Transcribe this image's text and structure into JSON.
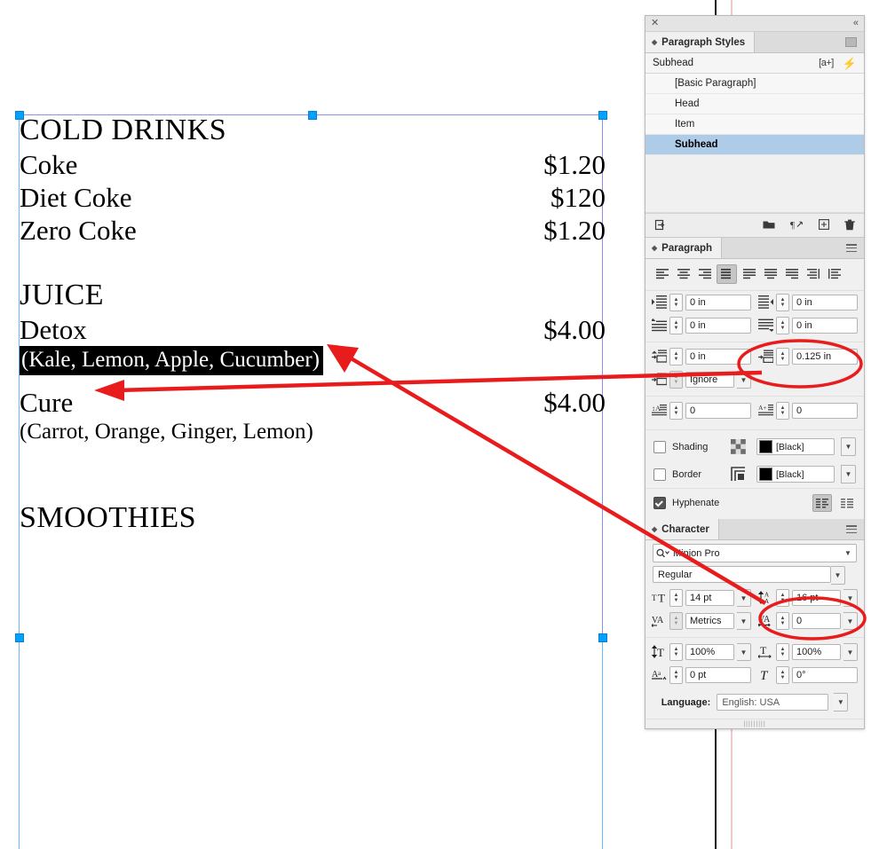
{
  "document": {
    "sections": [
      {
        "heading": "COLD DRINKS",
        "items": [
          {
            "name": "Coke",
            "price": "$1.20"
          },
          {
            "name": "Diet Coke",
            "price": "$120"
          },
          {
            "name": "Zero Coke",
            "price": "$1.20"
          }
        ]
      },
      {
        "heading": "JUICE",
        "items": [
          {
            "name": "Detox",
            "price": "$4.00",
            "desc": "(Kale, Lemon, Apple, Cucumber)",
            "highlighted": true
          },
          {
            "name": "Cure",
            "price": "$4.00",
            "desc": "(Carrot, Orange, Ginger, Lemon)",
            "highlighted": false
          }
        ]
      },
      {
        "heading": "SMOOTHIES",
        "items": []
      }
    ]
  },
  "panel": {
    "close_label": "✕",
    "collapse_label": "«",
    "paragraph_styles": {
      "tab_label": "Paragraph Styles",
      "current_style": "Subhead",
      "override_badge": "[a+]",
      "quick_apply": "⚡",
      "styles": [
        "[Basic Paragraph]",
        "Head",
        "Item",
        "Subhead"
      ],
      "selected_style": "Subhead",
      "footer_icons": [
        "load-styles-icon",
        "new-group-icon",
        "clear-overrides-icon",
        "new-style-icon",
        "delete-style-icon"
      ]
    },
    "paragraph": {
      "tab_label": "Paragraph",
      "alignment_options": [
        "align-left",
        "align-center",
        "align-right",
        "justify-all-lines",
        "justify-last-left",
        "justify-last-center",
        "justify-last-right",
        "align-toward-spine",
        "align-away-from-spine"
      ],
      "alignment_selected_index": 3,
      "fields": {
        "left_indent": "0 in",
        "right_indent": "0 in",
        "first_line_indent": "0 in",
        "last_line_indent": "0 in",
        "space_before": "0 in",
        "space_after": "0.125 in",
        "align_to_grid": "Ignore",
        "drop_cap_lines": "0",
        "drop_cap_chars": "0"
      },
      "shading": {
        "label": "Shading",
        "checked": false,
        "color": "[Black]"
      },
      "border": {
        "label": "Border",
        "checked": false,
        "color": "[Black]"
      },
      "hyphenate": {
        "label": "Hyphenate",
        "checked": true
      }
    },
    "character": {
      "tab_label": "Character",
      "font_family": "Minion Pro",
      "font_style": "Regular",
      "font_size": "14 pt",
      "leading": "16 pt",
      "kerning": "Metrics",
      "tracking": "0",
      "vertical_scale": "100%",
      "horizontal_scale": "100%",
      "baseline_shift": "0 pt",
      "skew": "0°",
      "language_label": "Language:",
      "language_value": "English: USA"
    }
  },
  "annotations": {
    "highlight_color": "#e81c1c",
    "callouts": [
      {
        "name": "space-after-callout",
        "target_field": "space_after",
        "value": "0.125 in"
      },
      {
        "name": "leading-callout",
        "target_field": "leading",
        "value": "16 pt"
      }
    ]
  },
  "colors": {
    "panel_bg": "#f0f0f0",
    "selection_blue": "#aecbe8",
    "frame_handle": "#00a2ff",
    "annotation_red": "#e81c1c",
    "guide_pink": "#f9c3cb"
  }
}
